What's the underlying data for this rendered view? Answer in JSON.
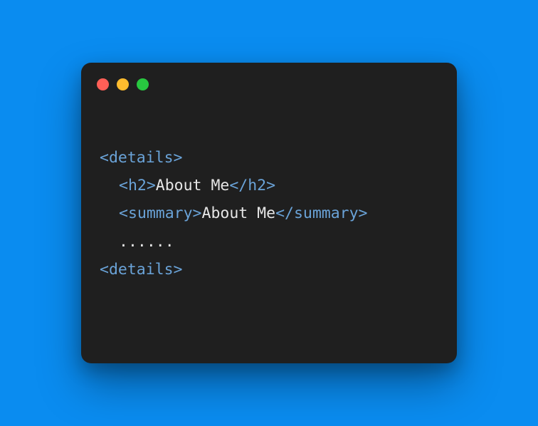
{
  "code": {
    "line1": {
      "tag_open": "<details>"
    },
    "line2": {
      "tag_open": "<h2>",
      "text": "About Me",
      "tag_close": "</h2>"
    },
    "line3": {
      "tag_open": "<summary>",
      "text": "About Me",
      "tag_close": "</summary>"
    },
    "line4": {
      "text": "......"
    },
    "line5": {
      "tag_open": "<details>"
    }
  }
}
